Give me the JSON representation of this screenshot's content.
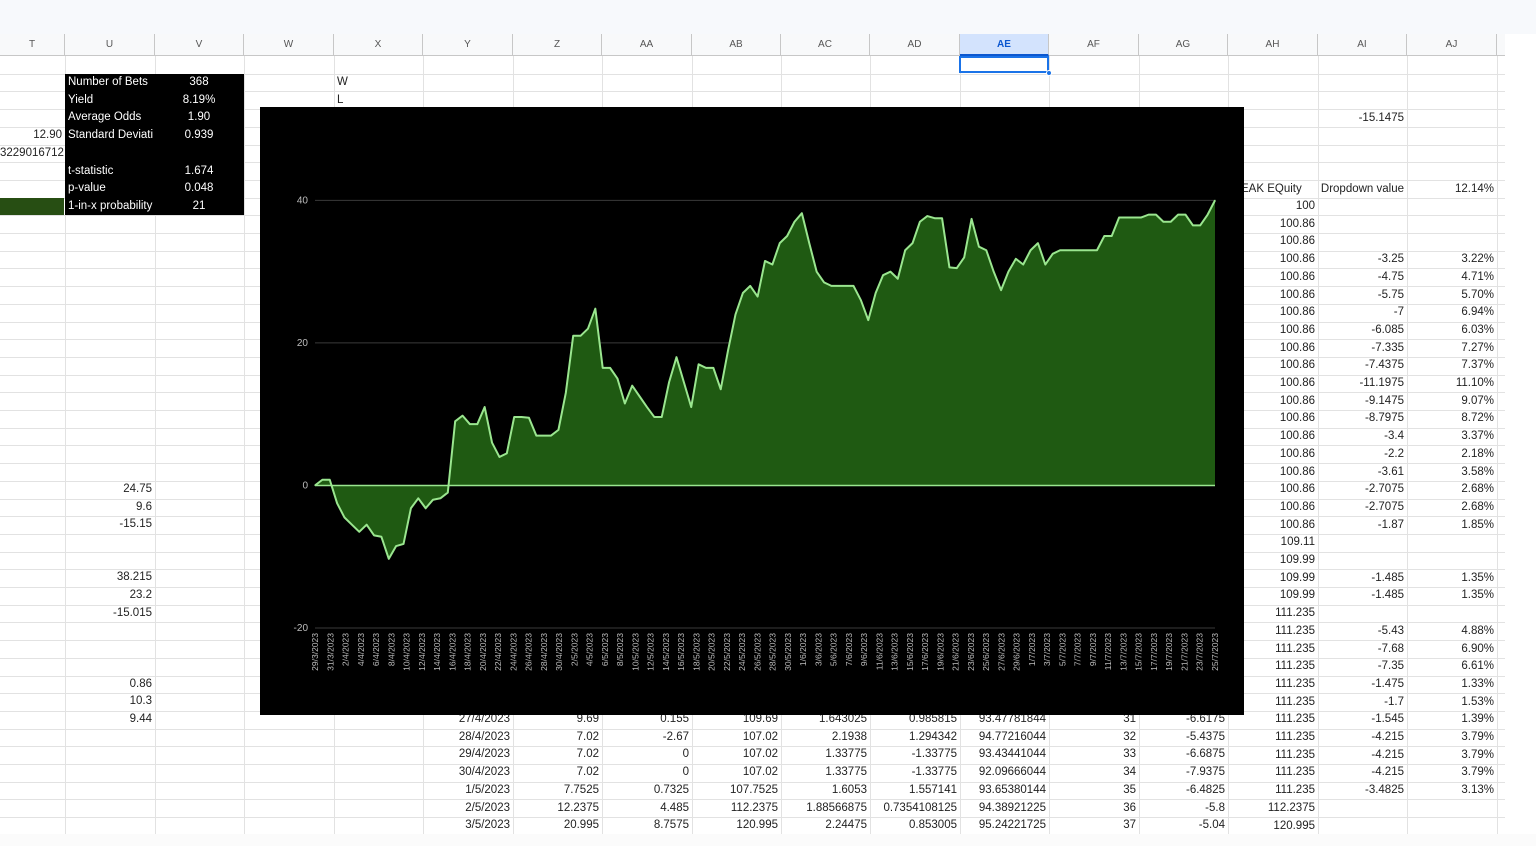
{
  "columns": [
    "T",
    "U",
    "V",
    "W",
    "X",
    "Y",
    "Z",
    "AA",
    "AB",
    "AC",
    "AD",
    "AE",
    "AF",
    "AG",
    "AH",
    "AI",
    "AJ"
  ],
  "active_column": "AE",
  "stats_box": [
    {
      "label": "Number of Bets",
      "value": "368"
    },
    {
      "label": "Yield",
      "value": "8.19%"
    },
    {
      "label": "Average Odds",
      "value": "1.90"
    },
    {
      "label": "Standard Deviati",
      "value": "0.939"
    },
    {
      "label": "",
      "value": ""
    },
    {
      "label": "t-statistic",
      "value": "1.674"
    },
    {
      "label": "p-value",
      "value": "0.048"
    },
    {
      "label": "1-in-x probability",
      "value": "21"
    }
  ],
  "t_col": [
    "",
    "",
    "",
    "12.90",
    "3229016712"
  ],
  "wl": [
    "W",
    "L"
  ],
  "u_col": [
    {
      "row": 24,
      "v": "24.75"
    },
    {
      "row": 25,
      "v": "9.6"
    },
    {
      "row": 26,
      "v": "-15.15"
    },
    {
      "row": 29,
      "v": "38.215"
    },
    {
      "row": 30,
      "v": "23.2"
    },
    {
      "row": 31,
      "v": "-15.015"
    },
    {
      "row": 35,
      "v": "0.86"
    },
    {
      "row": 36,
      "v": "10.3"
    },
    {
      "row": 37,
      "v": "9.44"
    }
  ],
  "ai_top": "-15.1475",
  "right_header": {
    "ah": "EAK EQuity",
    "ai": "Dropdown value",
    "aj": "12.14%"
  },
  "right_rows": [
    {
      "ah": "100",
      "ai": "",
      "aj": ""
    },
    {
      "ah": "100.86",
      "ai": "",
      "aj": ""
    },
    {
      "ah": "100.86",
      "ai": "",
      "aj": ""
    },
    {
      "ah": "100.86",
      "ai": "-3.25",
      "aj": "3.22%"
    },
    {
      "ah": "100.86",
      "ai": "-4.75",
      "aj": "4.71%"
    },
    {
      "ah": "100.86",
      "ai": "-5.75",
      "aj": "5.70%"
    },
    {
      "ah": "100.86",
      "ai": "-7",
      "aj": "6.94%"
    },
    {
      "ah": "100.86",
      "ai": "-6.085",
      "aj": "6.03%"
    },
    {
      "ah": "100.86",
      "ai": "-7.335",
      "aj": "7.27%"
    },
    {
      "ah": "100.86",
      "ai": "-7.4375",
      "aj": "7.37%"
    },
    {
      "ah": "100.86",
      "ai": "-11.1975",
      "aj": "11.10%"
    },
    {
      "ah": "100.86",
      "ai": "-9.1475",
      "aj": "9.07%"
    },
    {
      "ah": "100.86",
      "ai": "-8.7975",
      "aj": "8.72%"
    },
    {
      "ah": "100.86",
      "ai": "-3.4",
      "aj": "3.37%"
    },
    {
      "ah": "100.86",
      "ai": "-2.2",
      "aj": "2.18%"
    },
    {
      "ah": "100.86",
      "ai": "-3.61",
      "aj": "3.58%"
    },
    {
      "ah": "100.86",
      "ai": "-2.7075",
      "aj": "2.68%"
    },
    {
      "ah": "100.86",
      "ai": "-2.7075",
      "aj": "2.68%"
    },
    {
      "ah": "100.86",
      "ai": "-1.87",
      "aj": "1.85%"
    },
    {
      "ah": "109.11",
      "ai": "",
      "aj": ""
    },
    {
      "ah": "109.99",
      "ai": "",
      "aj": ""
    },
    {
      "ah": "109.99",
      "ai": "-1.485",
      "aj": "1.35%"
    },
    {
      "ah": "109.99",
      "ai": "-1.485",
      "aj": "1.35%"
    },
    {
      "ah": "111.235",
      "ai": "",
      "aj": ""
    },
    {
      "ah": "111.235",
      "ai": "-5.43",
      "aj": "4.88%"
    },
    {
      "ah": "111.235",
      "ai": "-7.68",
      "aj": "6.90%"
    },
    {
      "ah": "111.235",
      "ai": "-7.35",
      "aj": "6.61%"
    },
    {
      "ah": "111.235",
      "ai": "-1.475",
      "aj": "1.33%"
    },
    {
      "ah": "111.235",
      "ai": "-1.7",
      "aj": "1.53%"
    },
    {
      "ah": "111.235",
      "ai": "-1.545",
      "aj": "1.39%"
    },
    {
      "ah": "111.235",
      "ai": "-4.215",
      "aj": "3.79%"
    },
    {
      "ah": "111.235",
      "ai": "-4.215",
      "aj": "3.79%"
    },
    {
      "ah": "111.235",
      "ai": "-4.215",
      "aj": "3.79%"
    },
    {
      "ah": "111.235",
      "ai": "-3.4825",
      "aj": "3.13%"
    },
    {
      "ah": "112.2375",
      "ai": "",
      "aj": ""
    },
    {
      "ah": "120.995",
      "ai": "",
      "aj": ""
    }
  ],
  "bottom_rows": [
    [
      "27/4/2023",
      "9.69",
      "0.155",
      "109.69",
      "1.643025",
      "0.985815",
      "93.47781844",
      "31",
      "-6.6175"
    ],
    [
      "28/4/2023",
      "7.02",
      "-2.67",
      "107.02",
      "2.1938",
      "1.294342",
      "94.77216044",
      "32",
      "-5.4375"
    ],
    [
      "29/4/2023",
      "7.02",
      "0",
      "107.02",
      "1.33775",
      "-1.33775",
      "93.43441044",
      "33",
      "-6.6875"
    ],
    [
      "30/4/2023",
      "7.02",
      "0",
      "107.02",
      "1.33775",
      "-1.33775",
      "92.09666044",
      "34",
      "-7.9375"
    ],
    [
      "1/5/2023",
      "7.7525",
      "0.7325",
      "107.7525",
      "1.6053",
      "1.557141",
      "93.65380144",
      "35",
      "-6.4825"
    ],
    [
      "2/5/2023",
      "12.2375",
      "4.485",
      "112.2375",
      "1.88566875",
      "0.7354108125",
      "94.38921225",
      "36",
      "-5.8"
    ],
    [
      "3/5/2023",
      "20.995",
      "8.7575",
      "120.995",
      "2.24475",
      "0.853005",
      "95.24221725",
      "37",
      "-5.04"
    ]
  ],
  "chart_data": {
    "type": "area",
    "title": "",
    "xlabel": "",
    "ylabel": "",
    "ylim": [
      -20,
      43
    ],
    "yticks": [
      40,
      20,
      0,
      -20
    ],
    "grid": true,
    "legend": "none",
    "colors": {
      "fill": "#1f5a12",
      "line": "#9ae68f",
      "background": "#000000"
    },
    "x_tick_labels": [
      "29/3/2023",
      "31/3/2023",
      "2/4/2023",
      "4/4/2023",
      "6/4/2023",
      "8/4/2023",
      "10/4/2023",
      "12/4/2023",
      "14/4/2023",
      "16/4/2023",
      "18/4/2023",
      "20/4/2023",
      "22/4/2023",
      "24/4/2023",
      "26/4/2023",
      "28/4/2023",
      "30/4/2023",
      "2/5/2023",
      "4/5/2023",
      "6/5/2023",
      "8/5/2023",
      "10/5/2023",
      "12/5/2023",
      "14/5/2023",
      "16/5/2023",
      "18/5/2023",
      "20/5/2023",
      "22/5/2023",
      "24/5/2023",
      "26/5/2023",
      "28/5/2023",
      "30/5/2023",
      "1/6/2023",
      "3/6/2023",
      "5/6/2023",
      "7/6/2023",
      "9/6/2023",
      "11/6/2023",
      "13/6/2023",
      "15/6/2023",
      "17/6/2023",
      "19/6/2023",
      "21/6/2023",
      "23/6/2023",
      "25/6/2023",
      "27/6/2023",
      "29/6/2023",
      "1/7/2023",
      "3/7/2023",
      "5/7/2023",
      "7/7/2023",
      "9/7/2023",
      "11/7/2023",
      "13/7/2023",
      "15/7/2023",
      "17/7/2023",
      "19/7/2023",
      "21/7/2023",
      "23/7/2023",
      "25/7/2023"
    ],
    "values": [
      0,
      0.8,
      0.8,
      -2.5,
      -4.5,
      -5.5,
      -6.5,
      -5.5,
      -7,
      -7.2,
      -10.3,
      -8.5,
      -8.2,
      -3.2,
      -1.8,
      -3.2,
      -2,
      -1.8,
      -1,
      9,
      9.8,
      8.6,
      8.6,
      11,
      6,
      4,
      4.5,
      9.6,
      9.6,
      9.5,
      7,
      7,
      7,
      7.8,
      13,
      21,
      21,
      22,
      24.8,
      16.5,
      16.5,
      15,
      11.5,
      14,
      12.5,
      11,
      9.6,
      9.6,
      14.5,
      18,
      14.5,
      11,
      17,
      16.5,
      16.5,
      13.5,
      19,
      24,
      27,
      28,
      26.5,
      31.5,
      31,
      34,
      35,
      37,
      38.2,
      34,
      30,
      28.5,
      28,
      28,
      28,
      28,
      26,
      23.2,
      27,
      29.5,
      30,
      29,
      33,
      34,
      37,
      37.8,
      37.5,
      37.5,
      30.6,
      30.5,
      32,
      37.4,
      33.5,
      33,
      30,
      27.4,
      30,
      31.8,
      31,
      33,
      34,
      31,
      32.5,
      33,
      33,
      33,
      33,
      33,
      33,
      35,
      35,
      37.6,
      37.6,
      37.6,
      37.6,
      38,
      38,
      37,
      37,
      38,
      38,
      36.5,
      36.5,
      38,
      40
    ]
  }
}
